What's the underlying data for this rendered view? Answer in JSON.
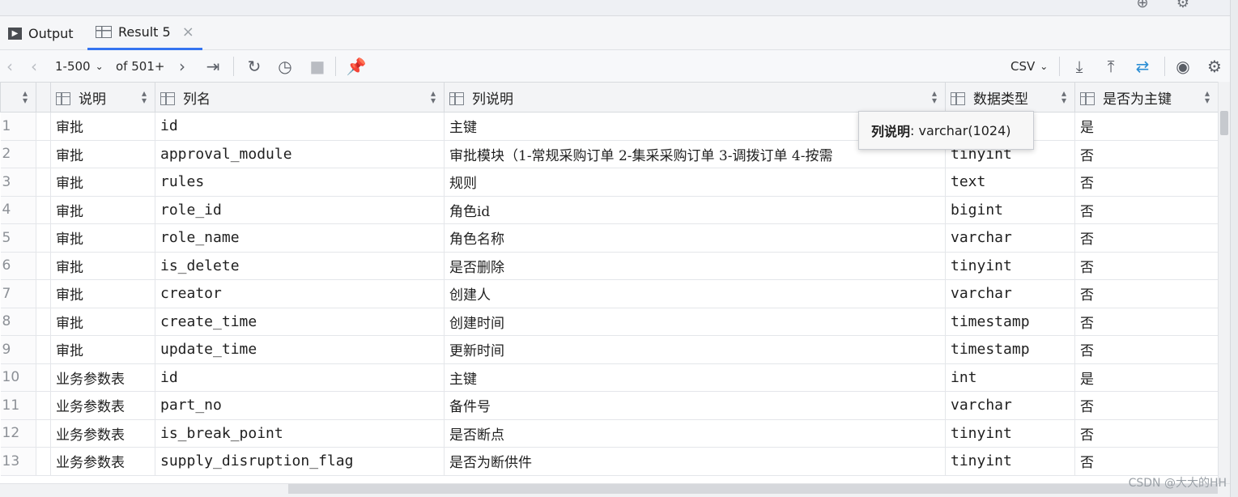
{
  "topstrip": {
    "icons": [
      "globe-icon",
      "gear-icon"
    ]
  },
  "tabs": [
    {
      "label": "Output",
      "icon": "console-icon"
    },
    {
      "label": "Result 5",
      "icon": "table-icon",
      "close": "×"
    }
  ],
  "toolbar": {
    "range": "1-500",
    "of_label": "of 501+",
    "export_format": "CSV"
  },
  "columns": [
    "说明",
    "列名",
    "列说明",
    "数据类型",
    "是否为主键"
  ],
  "rows": [
    {
      "n": "1",
      "desc": "审批",
      "name": "id",
      "comment": "主键",
      "type": "",
      "pk": "是"
    },
    {
      "n": "2",
      "desc": "审批",
      "name": "approval_module",
      "comment": "审批模块（1-常规采购订单  2-集采采购订单  3-调拨订单  4-按需",
      "type": "tinyint",
      "pk": "否"
    },
    {
      "n": "3",
      "desc": "审批",
      "name": "rules",
      "comment": "规则",
      "type": "text",
      "pk": "否"
    },
    {
      "n": "4",
      "desc": "审批",
      "name": "role_id",
      "comment": "角色id",
      "type": "bigint",
      "pk": "否"
    },
    {
      "n": "5",
      "desc": "审批",
      "name": "role_name",
      "comment": "角色名称",
      "type": "varchar",
      "pk": "否"
    },
    {
      "n": "6",
      "desc": "审批",
      "name": "is_delete",
      "comment": "是否删除",
      "type": "tinyint",
      "pk": "否"
    },
    {
      "n": "7",
      "desc": "审批",
      "name": "creator",
      "comment": "创建人",
      "type": "varchar",
      "pk": "否"
    },
    {
      "n": "8",
      "desc": "审批",
      "name": "create_time",
      "comment": "创建时间",
      "type": "timestamp",
      "pk": "否"
    },
    {
      "n": "9",
      "desc": "审批",
      "name": "update_time",
      "comment": "更新时间",
      "type": "timestamp",
      "pk": "否"
    },
    {
      "n": "10",
      "desc": "业务参数表",
      "name": "id",
      "comment": "主键",
      "type": "int",
      "pk": "是"
    },
    {
      "n": "11",
      "desc": "业务参数表",
      "name": "part_no",
      "comment": "备件号",
      "type": "varchar",
      "pk": "否"
    },
    {
      "n": "12",
      "desc": "业务参数表",
      "name": "is_break_point",
      "comment": "是否断点",
      "type": "tinyint",
      "pk": "否"
    },
    {
      "n": "13",
      "desc": "业务参数表",
      "name": "supply_disruption_flag",
      "comment": "是否为断供件",
      "type": "tinyint",
      "pk": "否"
    }
  ],
  "tooltip": {
    "label": "列说明",
    "value": ": varchar(1024)"
  },
  "watermark": "CSDN @大大的HH"
}
